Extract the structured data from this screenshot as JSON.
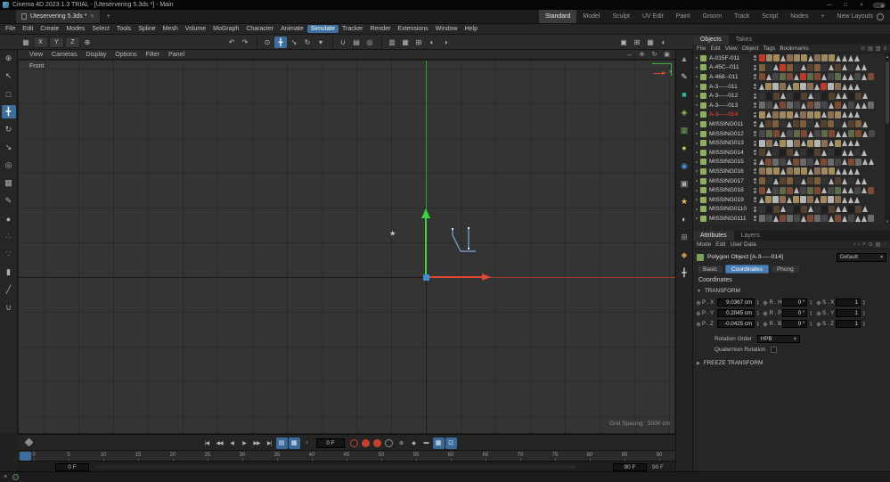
{
  "window": {
    "title": "Cinema 4D 2023.1.3 TRIAL - [Uteservering 5.3ds *] - Main",
    "controls": [
      {
        "name": "minimize-button",
        "glyph": "—"
      },
      {
        "name": "maximize-button",
        "glyph": "□"
      },
      {
        "name": "close-button",
        "glyph": "×"
      }
    ]
  },
  "tabbar": {
    "document_tab": "Uteservering 5.3ds *",
    "close_glyph": "×",
    "add_glyph": "+",
    "layouts": [
      "Standard",
      "Model",
      "Sculpt",
      "UV Edit",
      "Paint",
      "Groom",
      "Track",
      "Script",
      "Nodes"
    ],
    "active_layout": "Standard",
    "add_layout_glyph": "+",
    "new_layouts_label": "New Layouts"
  },
  "menubar": {
    "items": [
      "File",
      "Edit",
      "Create",
      "Modes",
      "Select",
      "Tools",
      "Spline",
      "Mesh",
      "Volume",
      "MoGraph",
      "Character",
      "Animate",
      "Simulate",
      "Tracker",
      "Render",
      "Extensions",
      "Window",
      "Help"
    ],
    "highlighted": "Simulate"
  },
  "toolbar": {
    "left": [
      {
        "name": "workplane-icon",
        "glyph": "▦"
      },
      {
        "name": "lock-x-axis-button",
        "glyph": "X",
        "axis": true
      },
      {
        "name": "lock-y-axis-button",
        "glyph": "Y",
        "axis": true
      },
      {
        "name": "lock-z-axis-button",
        "glyph": "Z",
        "axis": true
      },
      {
        "name": "coordinate-system-button",
        "glyph": "⊕"
      }
    ],
    "center": [
      {
        "name": "undo-button",
        "glyph": "↶"
      },
      {
        "name": "redo-button",
        "glyph": "↷"
      },
      {
        "sep": true
      },
      {
        "name": "live-selection-button",
        "glyph": "⊙"
      },
      {
        "name": "move-tool-button",
        "glyph": "╋",
        "active": true
      },
      {
        "name": "scale-tool-button",
        "glyph": "↘"
      },
      {
        "name": "rotate-tool-button",
        "glyph": "↻"
      },
      {
        "name": "last-tool-button",
        "glyph": "▾"
      },
      {
        "sep": true
      },
      {
        "name": "snap-button",
        "glyph": "∪"
      },
      {
        "name": "quantize-button",
        "glyph": "▤"
      },
      {
        "name": "modeling-axis-button",
        "glyph": "◎"
      },
      {
        "sep": true
      },
      {
        "name": "simulate-cloth-button",
        "glyph": "▥"
      },
      {
        "name": "simulate-rope-button",
        "glyph": "▦"
      },
      {
        "name": "simulate-rigid-button",
        "glyph": "⊞"
      },
      {
        "name": "render-view-button",
        "glyph": "◐"
      },
      {
        "name": "render-settings-button",
        "glyph": "◑"
      }
    ],
    "right": [
      {
        "name": "viewport-layout-single-button",
        "glyph": "▣"
      },
      {
        "name": "viewport-layout-quad-button",
        "glyph": "⊞"
      },
      {
        "name": "viewport-layout-split-button",
        "glyph": "▦"
      },
      {
        "name": "material-sphere-button",
        "glyph": "◐"
      }
    ]
  },
  "left_toolbar": [
    {
      "name": "zoom-tool-button",
      "glyph": "⊕"
    },
    {
      "name": "select-tool-button",
      "glyph": "↖"
    },
    {
      "name": "rect-select-tool-button",
      "glyph": "□"
    },
    {
      "name": "move-tool-button",
      "glyph": "╋",
      "active": true
    },
    {
      "name": "rotate-tool-button",
      "glyph": "↻"
    },
    {
      "name": "scale-tool-button",
      "glyph": "↘"
    },
    {
      "name": "axis-modifier-button",
      "glyph": "◎"
    },
    {
      "name": "workplane-button",
      "glyph": "▦"
    },
    {
      "name": "pen-tool-button",
      "glyph": "✎"
    },
    {
      "name": "sculpt-tool-button",
      "glyph": "●"
    },
    {
      "name": "uv-points-button",
      "glyph": "∴",
      "color": "#d2803a"
    },
    {
      "name": "uv-polygons-button",
      "glyph": "∵",
      "color": "#d2803a"
    },
    {
      "name": "brush-tool-button",
      "glyph": "▮"
    },
    {
      "name": "knife-tool-button",
      "glyph": "╱"
    },
    {
      "name": "magnet-tool-button",
      "glyph": "∪"
    }
  ],
  "right_strip": [
    {
      "name": "landscape-icon",
      "glyph": "▲",
      "color": "#9a9a9a"
    },
    {
      "name": "spline-pen-icon",
      "glyph": "✎",
      "color": "#d8d8d8"
    },
    {
      "name": "cube-primitive-icon",
      "glyph": "■",
      "color": "#36b3a0"
    },
    {
      "name": "mograph-icon",
      "glyph": "◈",
      "color": "#8bc34a"
    },
    {
      "name": "volume-icon",
      "glyph": "▦",
      "color": "#66a055"
    },
    {
      "name": "dynamics-icon",
      "glyph": "●",
      "color": "#b5cc4a"
    },
    {
      "name": "field-icon",
      "glyph": "◉",
      "color": "#4a90d0"
    },
    {
      "name": "camera-icon",
      "glyph": "▣",
      "color": "#b0b0b0"
    },
    {
      "name": "light-icon",
      "glyph": "★",
      "color": "#e0c050"
    },
    {
      "name": "material-icon",
      "glyph": "◐",
      "color": "#c8c8c8"
    },
    {
      "name": "xpresso-icon",
      "glyph": "⊞",
      "color": "#9a9a9a"
    },
    {
      "name": "tag-icon",
      "glyph": "◆",
      "color": "#c08a4a"
    },
    {
      "name": "axis-icon",
      "glyph": "╋",
      "color": "#c4c4c4"
    }
  ],
  "viewport": {
    "menus": [
      "View",
      "Cameras",
      "Display",
      "Options",
      "Filter",
      "Panel"
    ],
    "nav_icons": [
      {
        "name": "pan-view-icon",
        "glyph": "↔"
      },
      {
        "name": "zoom-view-icon",
        "glyph": "⊕"
      },
      {
        "name": "rotate-view-icon",
        "glyph": "↻"
      },
      {
        "name": "toggle-view-icon",
        "glyph": "▣"
      }
    ],
    "view_label": "Front",
    "grid_spacing_label": "Grid Spacing : 5000 cm",
    "axis_x_label": "x"
  },
  "object_manager": {
    "tabs": [
      "Objects",
      "Takes"
    ],
    "active_tab": "Objects",
    "menus": [
      "File",
      "Edit",
      "View",
      "Object",
      "Tags",
      "Bookmarks"
    ],
    "menu_icons": [
      {
        "name": "search-icon",
        "glyph": "⊙"
      },
      {
        "name": "filter-icon",
        "glyph": "▤"
      },
      {
        "name": "list-icon",
        "glyph": "▥"
      },
      {
        "name": "options-icon",
        "glyph": "≡"
      }
    ],
    "objects": [
      {
        "name": "A-015F-011"
      },
      {
        "name": "A-45C--011"
      },
      {
        "name": "A-468--011"
      },
      {
        "name": "A-3-----011"
      },
      {
        "name": "A-3-----012"
      },
      {
        "name": "A-3-----013"
      },
      {
        "name": "A-3-----014",
        "selected": true
      },
      {
        "name": "MISSING011"
      },
      {
        "name": "MISSING012"
      },
      {
        "name": "MISSING013"
      },
      {
        "name": "MISSING014"
      },
      {
        "name": "MISSING015"
      },
      {
        "name": "MISSING016"
      },
      {
        "name": "MISSING017"
      },
      {
        "name": "MISSING018"
      },
      {
        "name": "MISSING019"
      },
      {
        "name": "MISSING0110"
      },
      {
        "name": "MISSING0111"
      }
    ],
    "selected_text_color": "#ff4a2d",
    "object_icon_color": "#8fae62",
    "tag_palette": [
      "#8a6f52",
      "#6b6b6b",
      "#55422e",
      "#9c8a67",
      "#474747",
      "#7d5f3f",
      "#a38c5a",
      "#5d6b4a",
      "#333333",
      "#b5b5b5",
      "#7a4a35",
      "#1f1f1f"
    ],
    "tag_red": "#c03a28",
    "tag_triangle_color": "#b8b8b8"
  },
  "attribute_manager": {
    "tabs": [
      "Attributes",
      "Layers"
    ],
    "active_tab": "Attributes",
    "menus": [
      "Mode",
      "Edit",
      "User Data"
    ],
    "menu_icons": [
      {
        "name": "back-icon",
        "glyph": "‹"
      },
      {
        "name": "forward-icon",
        "glyph": "›"
      },
      {
        "name": "up-icon",
        "glyph": "˄"
      },
      {
        "name": "search-icon",
        "glyph": "⊙"
      },
      {
        "name": "list-icon",
        "glyph": "▤"
      },
      {
        "name": "lock-icon",
        "glyph": "◌"
      }
    ],
    "object_title": "Polygon Object [A-3-----014]",
    "preset_value": "Default",
    "section_tabs": [
      "Basic",
      "Coordinates",
      "Phong"
    ],
    "active_section_tab": "Coordinates",
    "heading": "Coordinates",
    "transform_title": "TRANSFORM",
    "transform_arrow": "▼",
    "freeze_arrow": "▶",
    "transform_rows": [
      {
        "pl": "P . X",
        "pv": "9.0367 cm",
        "rl": "R . H",
        "rv": "0 °",
        "sl": "S . X",
        "sv": "1"
      },
      {
        "pl": "P . Y",
        "pv": "0.2045 cm",
        "rl": "R . P",
        "rv": "0 °",
        "sl": "S . Y",
        "sv": "1"
      },
      {
        "pl": "P . Z",
        "pv": "-0.0425 cm",
        "rl": "R . B",
        "rv": "0 °",
        "sl": "S . Z",
        "sv": "1"
      }
    ],
    "rotation_order_label": "Rotation Order",
    "rotation_order_value": "HPB",
    "quaternion_label": "Quaternion Rotation",
    "freeze_title": "FREEZE TRANSFORM"
  },
  "timeline": {
    "transport": [
      {
        "name": "goto-start-button",
        "glyph": "|◀"
      },
      {
        "name": "prev-key-button",
        "glyph": "◀◀"
      },
      {
        "name": "prev-frame-button",
        "glyph": "◀"
      },
      {
        "name": "play-button",
        "glyph": "▶"
      },
      {
        "name": "next-frame-button",
        "glyph": "▶▶"
      },
      {
        "name": "goto-end-button",
        "glyph": "▶|"
      }
    ],
    "mode_toggles": [
      {
        "name": "key-mode-button",
        "glyph": "▤"
      },
      {
        "name": "fcurve-mode-button",
        "glyph": "▦"
      }
    ],
    "sound_button_glyph": "♪",
    "current_frame": "0 F",
    "record_buttons": [
      {
        "name": "record-keyframe-button",
        "type": "ring-red"
      },
      {
        "name": "record-position-button",
        "type": "dot-red"
      },
      {
        "name": "record-rotation-button",
        "type": "dot-red"
      },
      {
        "name": "record-parameter-button",
        "type": "ring-gray"
      }
    ],
    "extra_buttons": [
      {
        "name": "autokey-button",
        "glyph": "⊕"
      },
      {
        "name": "set-key-button",
        "glyph": "◆"
      },
      {
        "name": "marker-button",
        "glyph": "▬"
      },
      {
        "name": "timeline-grid-button",
        "glyph": "▦",
        "blue": true
      },
      {
        "name": "timeline-range-button",
        "glyph": "⊡",
        "blue": true
      }
    ],
    "ticks": [
      "0",
      "5",
      "10",
      "15",
      "20",
      "25",
      "30",
      "35",
      "40",
      "45",
      "50",
      "55",
      "60",
      "65",
      "70",
      "75",
      "80",
      "85",
      "90"
    ],
    "range_start": "0 F",
    "range_end": "90 F",
    "total_label": "90 F"
  },
  "colors": {
    "accent_blue": "#3c6e9e",
    "tab_blue": "#4a7fb5",
    "axis_green": "#3fd03f",
    "axis_red": "#e04535",
    "origin_blue": "#3f8fd0",
    "selected_red": "#ff4a2d"
  }
}
